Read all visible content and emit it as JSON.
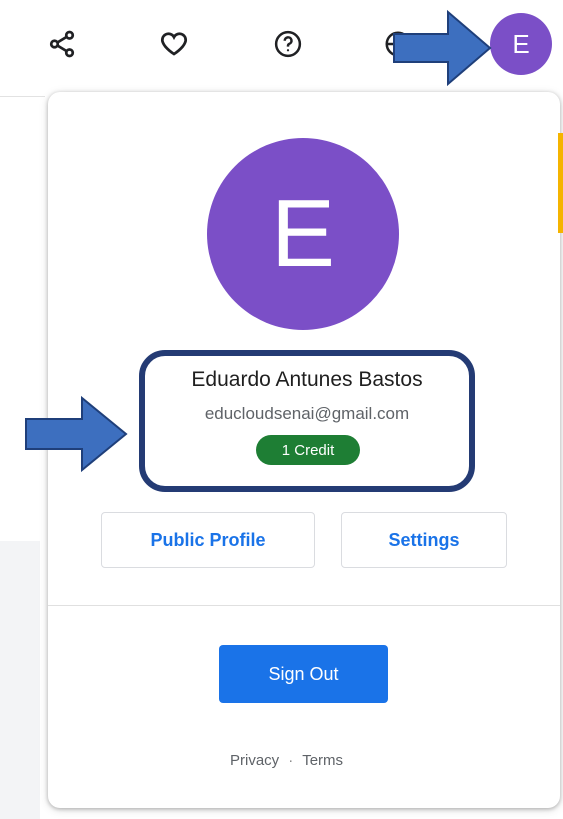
{
  "toolbar": {
    "icons": [
      "share-icon",
      "heart-icon",
      "help-icon",
      "grid-icon"
    ],
    "avatar_letter": "E"
  },
  "profile": {
    "avatar_letter": "E",
    "name": "Eduardo Antunes Bastos",
    "email": "educloudsenai@gmail.com",
    "credits": "1 Credit"
  },
  "buttons": {
    "public_profile": "Public Profile",
    "settings": "Settings",
    "sign_out": "Sign Out"
  },
  "footer": {
    "privacy": "Privacy",
    "separator": "·",
    "terms": "Terms"
  },
  "colors": {
    "avatar": "#7b4fc7",
    "primary": "#1a73e8",
    "credit_badge": "#1e7e34",
    "annotation": "#243b74",
    "arrow": "#3d6fbf"
  }
}
